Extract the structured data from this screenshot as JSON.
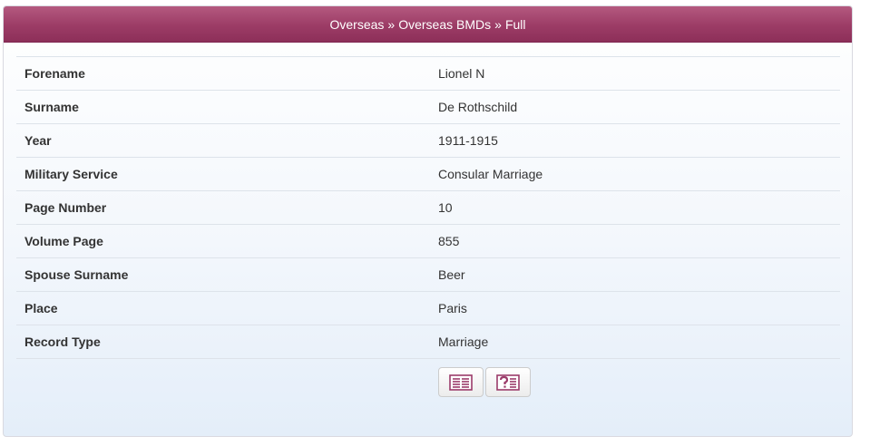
{
  "breadcrumb": {
    "items": [
      "Overseas",
      "Overseas BMDs",
      "Full"
    ],
    "separator": "»"
  },
  "record": {
    "rows": [
      {
        "label": "Forename",
        "value": "Lionel N"
      },
      {
        "label": "Surname",
        "value": "De Rothschild"
      },
      {
        "label": "Year",
        "value": "1911-1915"
      },
      {
        "label": "Military Service",
        "value": "Consular Marriage"
      },
      {
        "label": "Page Number",
        "value": "10"
      },
      {
        "label": "Volume Page",
        "value": "855"
      },
      {
        "label": "Spouse Surname",
        "value": "Beer"
      },
      {
        "label": "Place",
        "value": "Paris"
      },
      {
        "label": "Record Type",
        "value": "Marriage"
      }
    ]
  },
  "actions": {
    "view_icon": "document-view-icon",
    "help_icon": "question-document-icon"
  },
  "colors": {
    "header": "#9c3c66",
    "icon": "#9b3b6a"
  }
}
